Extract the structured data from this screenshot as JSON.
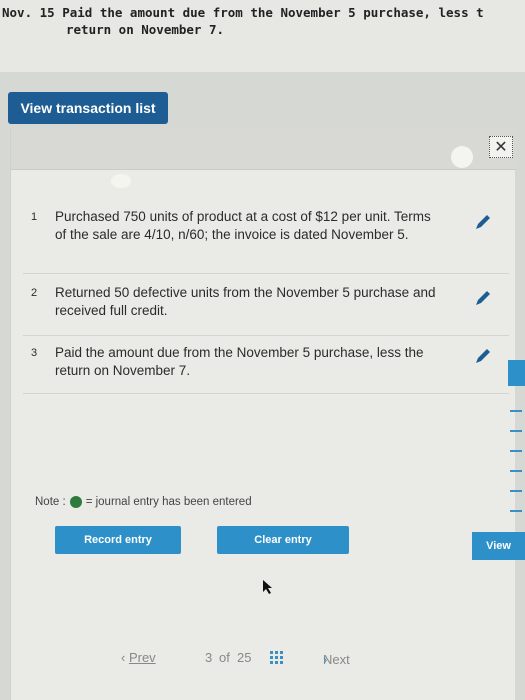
{
  "instruction": {
    "line1": "Nov. 15 Paid the amount due from the November 5 purchase, less t",
    "line2": "return on November 7."
  },
  "view_transaction_list_label": "View transaction list",
  "transactions": [
    {
      "num": "1",
      "text": "Purchased 750 units of product at a cost of $12 per unit. Terms of the sale are 4/10, n/60; the invoice is dated November 5."
    },
    {
      "num": "2",
      "text": "Returned 50 defective units from the November 5 purchase and received full credit."
    },
    {
      "num": "3",
      "text": "Paid the amount due from the November 5 purchase, less the return on November 7."
    }
  ],
  "note": {
    "prefix": "Note :",
    "suffix": "= journal entry has been entered"
  },
  "buttons": {
    "record": "Record entry",
    "clear": "Clear entry",
    "view": "View"
  },
  "pager": {
    "prev": "Prev",
    "current": "3",
    "of": "of",
    "total": "25",
    "next": "Next"
  },
  "colors": {
    "primary_button": "#1d5d93",
    "action_button": "#2d90c8",
    "entered_dot": "#2e7a3c"
  }
}
